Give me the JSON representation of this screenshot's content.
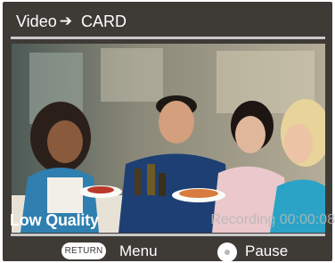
{
  "header": {
    "source": "Video",
    "arrow_icon": "right-arrow",
    "destination": "CARD"
  },
  "preview": {
    "description_icon": "live-camera-feed"
  },
  "status": {
    "quality": "Low Quality",
    "recording": "Recording 00:00:08"
  },
  "footer": {
    "return_key": "RETURN",
    "menu_label": "Menu",
    "enter_key_icon": "circle-button",
    "pause_label": "Pause"
  }
}
